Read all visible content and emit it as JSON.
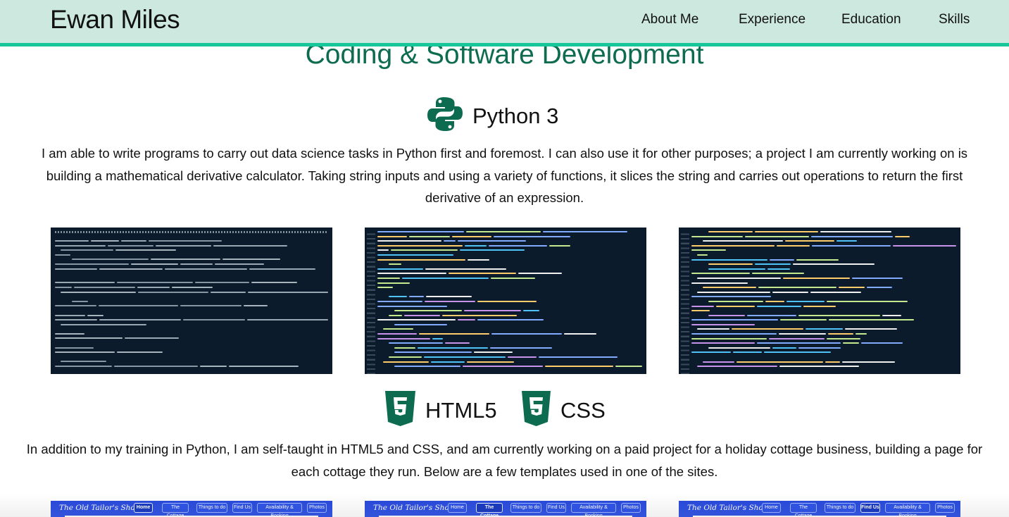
{
  "header": {
    "brand": "Ewan Miles",
    "nav": [
      "About Me",
      "Experience",
      "Education",
      "Skills"
    ]
  },
  "section_title": "Coding & Software Development",
  "python": {
    "label": "Python 3",
    "icon": "python-logo-icon",
    "description": "I am able to write programs to carry out data science tasks in Python first and foremost. I can also use it for other purposes; a project I am currently working on is building a mathematical derivative calculator. Taking string inputs and using a variety of functions, it slices the string and carries out operations to return the first derivative of an expression."
  },
  "web": {
    "html_label": "HTML5",
    "css_label": "CSS",
    "html_icon": "html5-shield-icon",
    "css_icon": "css3-shield-icon",
    "description": "In addition to my training in Python, I am self-taught in HTML5 and CSS, and am currently working on a paid project for a holiday cottage business, building a page for each cottage they run. Below are a few templates used in one of the sites."
  },
  "templates": [
    {
      "logo": "The Old Tailor's Shop",
      "nav": [
        "Home",
        "The Cottage",
        "Things to do",
        "Find Us",
        "Availability & Booking",
        "Photos"
      ],
      "active": 0
    },
    {
      "logo": "The Old Tailor's Shop",
      "nav": [
        "Home",
        "The Cottage",
        "Things to do",
        "Find Us",
        "Availability & Booking",
        "Photos"
      ],
      "active": 1
    },
    {
      "logo": "The Old Tailor's Shop",
      "nav": [
        "Home",
        "The Cottage",
        "Things to do",
        "Find Us",
        "Availability & Booking",
        "Photos"
      ],
      "active": 3
    }
  ],
  "colors": {
    "header_bg": "#cde9df",
    "accent_stripe": "#16c79a",
    "heading_green": "#0d6b4f",
    "code_bg": "#0c1b2b",
    "template_blue": "#2a4bdc"
  }
}
